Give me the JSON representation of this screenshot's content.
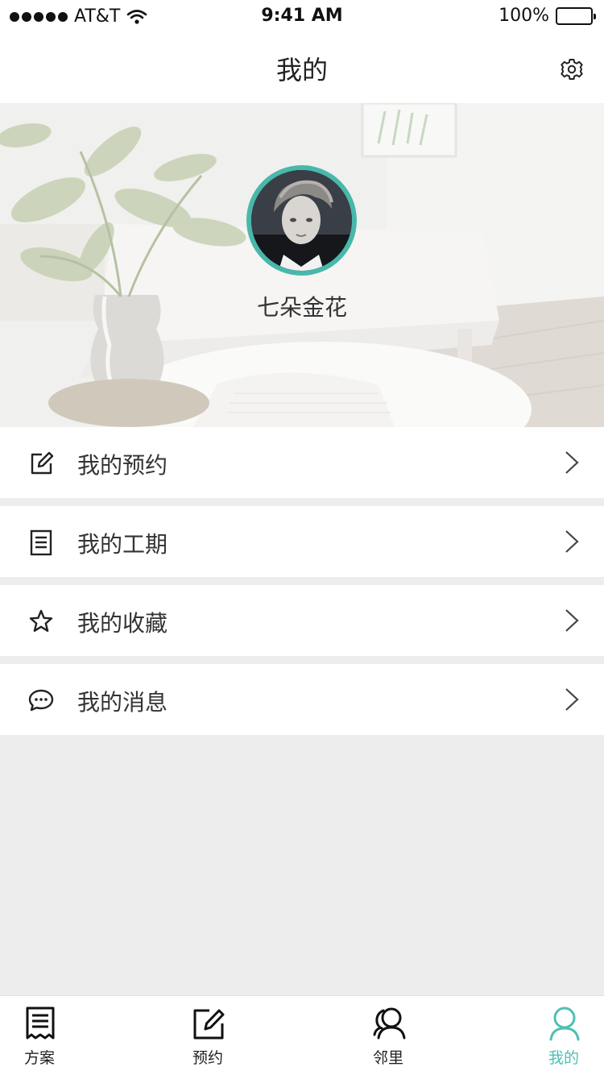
{
  "status_bar": {
    "carrier": "AT&T",
    "time": "9:41 AM",
    "battery": "100%"
  },
  "nav": {
    "title": "我的",
    "settings_icon": "gear-icon"
  },
  "profile": {
    "username": "七朵金花",
    "avatar_ring_color": "#48b8aa"
  },
  "menu": [
    {
      "label": "我的预约",
      "icon": "edit-icon"
    },
    {
      "label": "我的工期",
      "icon": "document-icon"
    },
    {
      "label": "我的收藏",
      "icon": "star-icon"
    },
    {
      "label": "我的消息",
      "icon": "chat-icon"
    }
  ],
  "tabs": [
    {
      "label": "方案",
      "icon": "plan-icon"
    },
    {
      "label": "预约",
      "icon": "edit-icon"
    },
    {
      "label": "邻里",
      "icon": "neighbors-icon"
    },
    {
      "label": "我的",
      "icon": "user-icon",
      "active": true
    }
  ],
  "colors": {
    "accent": "#4ec0b4",
    "background": "#ededed"
  }
}
